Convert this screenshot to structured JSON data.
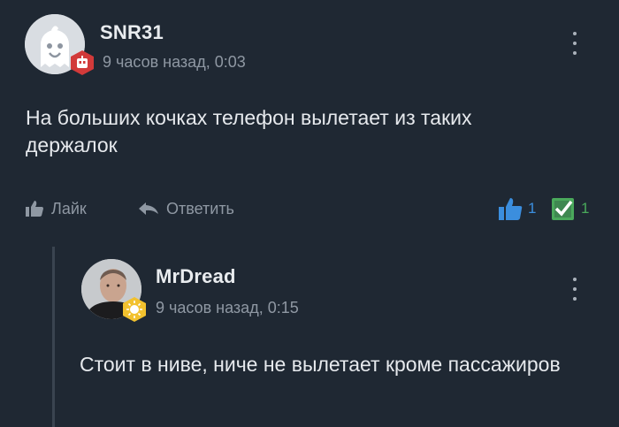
{
  "comment": {
    "username": "SNR31",
    "timestamp": "9 часов назад, 0:03",
    "text": "На больших кочках телефон вылетает из таких держалок",
    "actions": {
      "like_label": "Лайк",
      "reply_label": "Ответить"
    },
    "votes": {
      "thumbs_up": "1",
      "check": "1"
    },
    "badge_color": "#d23a3a",
    "avatar_icon": "ghost-avatar"
  },
  "reply": {
    "username": "MrDread",
    "timestamp": "9 часов назад, 0:15",
    "text": "Стоит в ниве, ниче не вылетает кроме пассажиров",
    "badge_color": "#f2c12e",
    "avatar_icon": "user-photo-avatar"
  },
  "theme": {
    "background": "#1f2833",
    "secondary_text": "#8f98a3",
    "accent_blue": "#3b8ede",
    "accent_green": "#4aa95b"
  }
}
